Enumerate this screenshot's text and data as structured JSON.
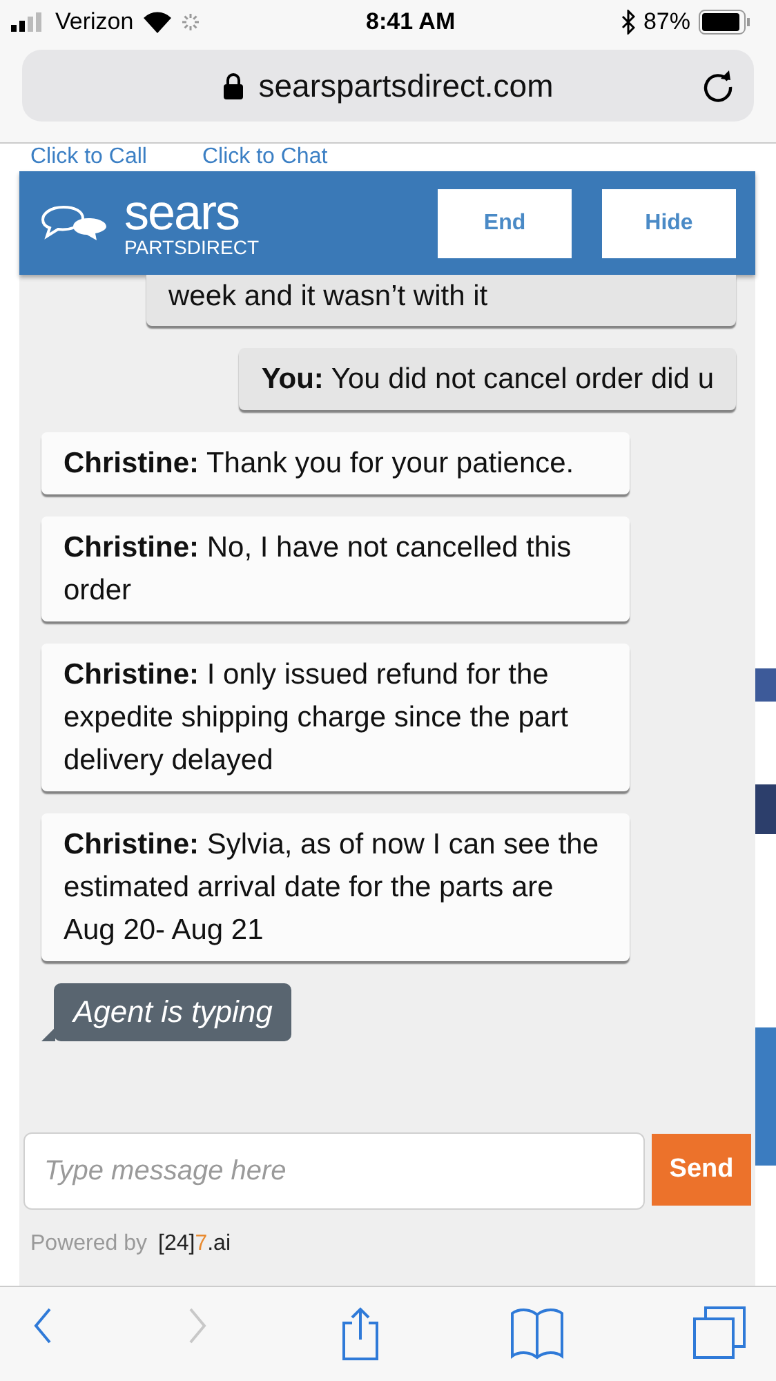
{
  "status_bar": {
    "carrier": "Verizon",
    "time": "8:41 AM",
    "battery": "87%"
  },
  "address_bar": {
    "url": "searspartsdirect.com"
  },
  "page_links": [
    "Click to Call",
    "Click to Chat"
  ],
  "chat": {
    "header": {
      "brand": "sears",
      "sub_brand": "PARTSDIRECT",
      "buttons": [
        "End",
        "Hide"
      ]
    },
    "messages": [
      {
        "kind": "you",
        "text": "week and it wasn’t with it"
      },
      {
        "kind": "you",
        "sender": "You:",
        "text": "You did not cancel order did u"
      },
      {
        "kind": "agent",
        "sender": "Christine:",
        "text": "Thank you for your patience."
      },
      {
        "kind": "agent",
        "sender": "Christine:",
        "text": "No, I have not cancelled this order"
      },
      {
        "kind": "agent",
        "sender": "Christine:",
        "text": "I only issued refund for the expedite shipping charge since the part delivery delayed"
      },
      {
        "kind": "agent",
        "sender": "Christine:",
        "text": "Sylvia, as of now I can see the estimated arrival date for the parts are Aug 20- Aug 21"
      }
    ],
    "typing": "Agent is typing",
    "input": {
      "placeholder": "Type message here"
    },
    "send": "Send",
    "powered_by": "Powered by",
    "powered_brand": [
      {
        "text": "[24]",
        "color": "#222222"
      },
      {
        "text": "7",
        "color": "#e8892e"
      },
      {
        "text": ".ai",
        "color": "#222222"
      }
    ]
  },
  "toolbar": [
    {
      "kind": "back",
      "disabled": false
    },
    {
      "kind": "forward",
      "disabled": true
    },
    {
      "kind": "share",
      "disabled": false
    },
    {
      "kind": "bookmarks",
      "disabled": false
    },
    {
      "kind": "tabs",
      "disabled": false
    }
  ]
}
